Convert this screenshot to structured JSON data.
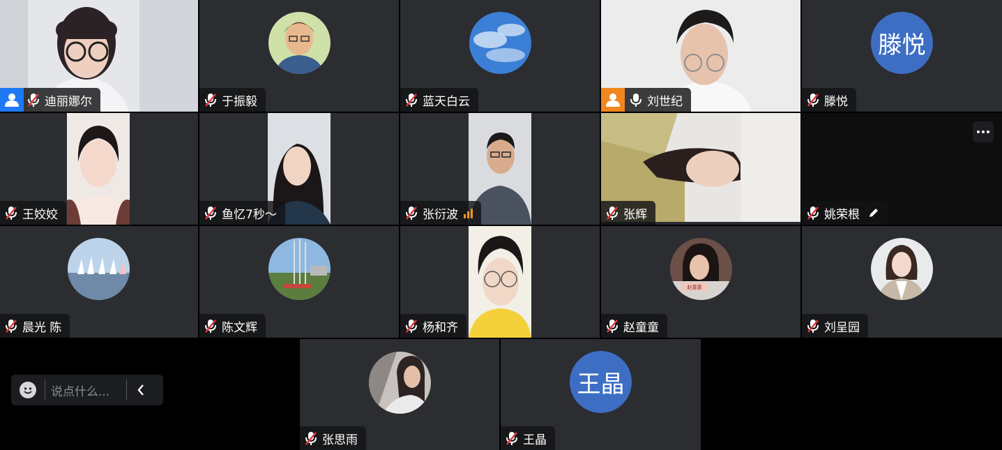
{
  "participants": [
    {
      "name": "迪丽娜尔",
      "mic": "muted",
      "host": true,
      "host_color": "#1f79f4"
    },
    {
      "name": "于振毅",
      "mic": "muted"
    },
    {
      "name": "蓝天白云",
      "mic": "muted"
    },
    {
      "name": "刘世纪",
      "mic": "on",
      "host": true,
      "host_color": "#f2861e"
    },
    {
      "name": "滕悦",
      "mic": "muted",
      "avatar_text": "滕悦"
    },
    {
      "name": "王姣姣",
      "mic": "muted"
    },
    {
      "name": "鱼忆7秒～",
      "mic": "muted"
    },
    {
      "name": "张衍波",
      "mic": "muted",
      "signal": "weak"
    },
    {
      "name": "张辉",
      "mic": "muted"
    },
    {
      "name": "姚荣根",
      "mic": "muted",
      "editing": true
    },
    {
      "name": "晨光 陈",
      "mic": "muted"
    },
    {
      "name": "陈文辉",
      "mic": "muted"
    },
    {
      "name": "杨和齐",
      "mic": "muted"
    },
    {
      "name": "赵童童",
      "mic": "muted",
      "avatar_caption": "赵童童"
    },
    {
      "name": "刘呈园",
      "mic": "muted"
    },
    {
      "name": "张思雨",
      "mic": "muted"
    },
    {
      "name": "王晶",
      "mic": "muted",
      "avatar_text": "王晶"
    }
  ],
  "chat": {
    "placeholder": "说点什么..."
  },
  "icons": {
    "more": "more-options-icon",
    "chat_emoji": "emoji-icon",
    "chat_collapse": "chevron-left-icon"
  },
  "colors": {
    "tile_bg": "#2b2d31",
    "avatar_blue": "#3d6ec4",
    "signal": "#f29324",
    "muted_slash": "#e0393e"
  }
}
